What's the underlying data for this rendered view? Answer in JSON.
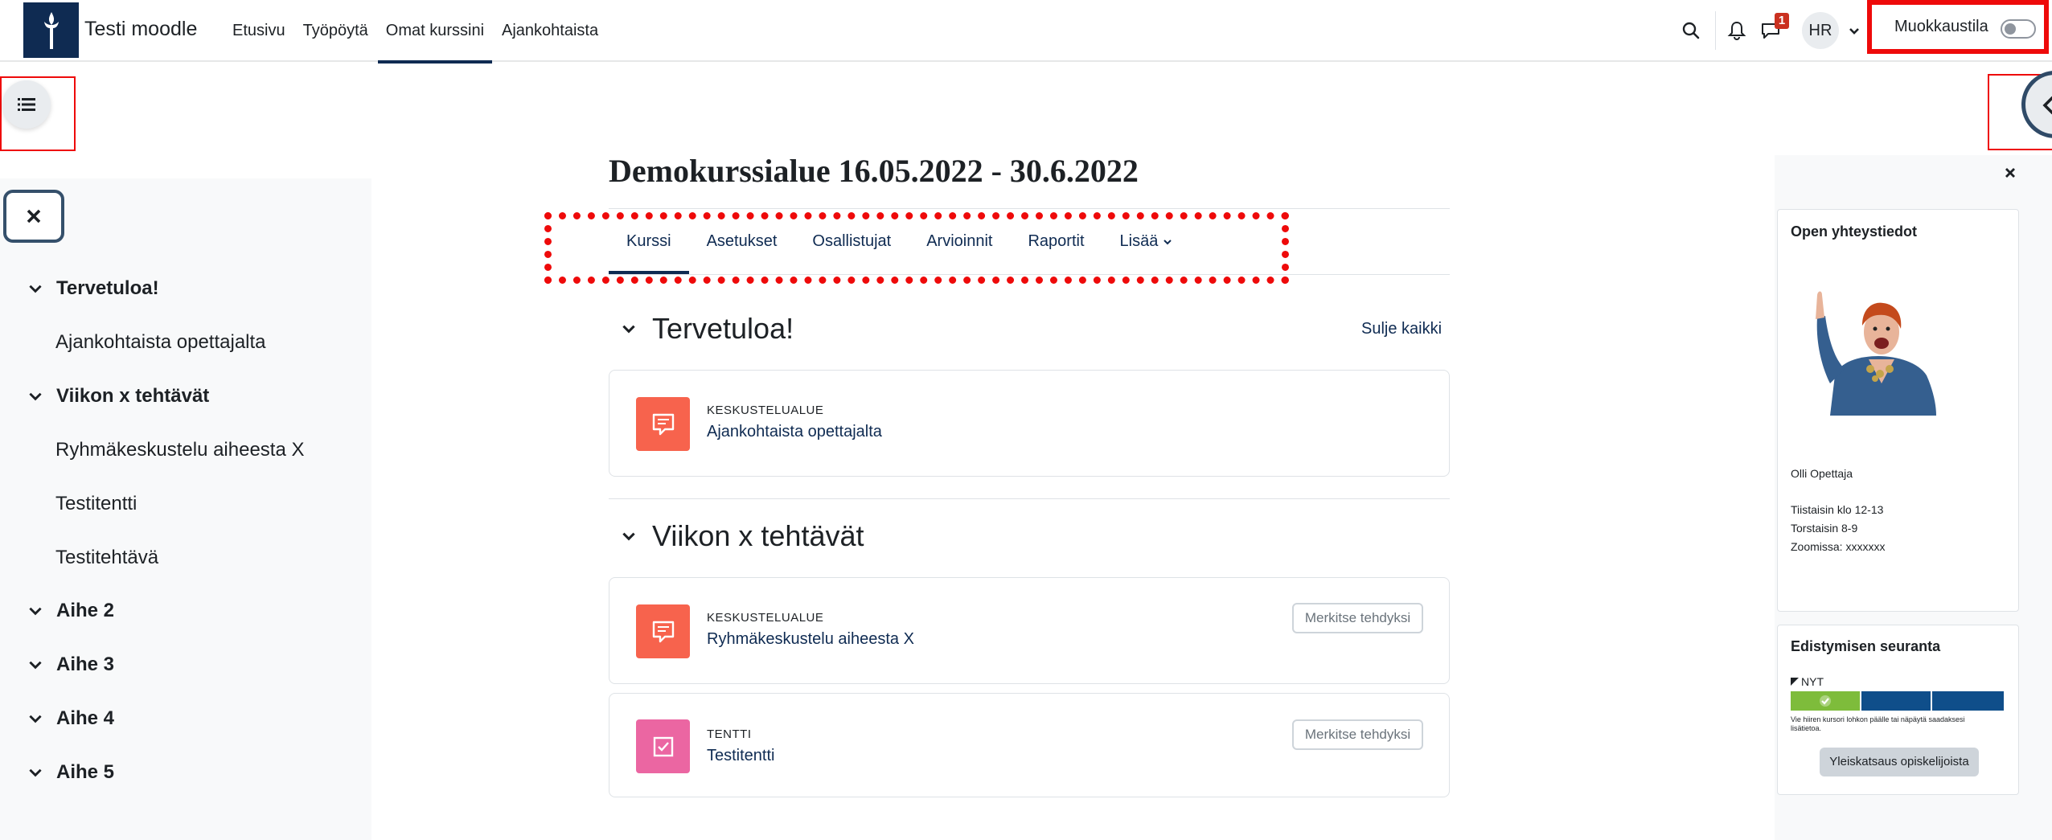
{
  "navbar": {
    "site_name": "Testi moodle",
    "primary_nav": [
      {
        "label": "Etusivu",
        "active": false
      },
      {
        "label": "Työpöytä",
        "active": false
      },
      {
        "label": "Omat kurssini",
        "active": true
      },
      {
        "label": "Ajankohtaista",
        "active": false
      }
    ],
    "messages_badge": "1",
    "user_initials": "HR",
    "edit_mode_label": "Muokkaustila",
    "edit_mode_on": false,
    "icons": [
      "search-icon",
      "bell-icon",
      "chat-icon",
      "chevron-down-icon"
    ]
  },
  "course_index": {
    "items": [
      {
        "label": "Tervetuloa!",
        "type": "section"
      },
      {
        "label": "Ajankohtaista opettajalta",
        "type": "activity"
      },
      {
        "label": "Viikon x tehtävät",
        "type": "section"
      },
      {
        "label": "Ryhmäkeskustelu aiheesta X",
        "type": "activity"
      },
      {
        "label": "Testitentti",
        "type": "activity"
      },
      {
        "label": "Testitehtävä",
        "type": "activity"
      },
      {
        "label": "Aihe 2",
        "type": "section"
      },
      {
        "label": "Aihe 3",
        "type": "section"
      },
      {
        "label": "Aihe 4",
        "type": "section"
      },
      {
        "label": "Aihe 5",
        "type": "section"
      }
    ]
  },
  "course": {
    "title": "Demokurssialue 16.05.2022 - 30.6.2022",
    "tabs": [
      {
        "label": "Kurssi",
        "active": true
      },
      {
        "label": "Asetukset",
        "active": false
      },
      {
        "label": "Osallistujat",
        "active": false
      },
      {
        "label": "Arvioinnit",
        "active": false
      },
      {
        "label": "Raportit",
        "active": false
      },
      {
        "label": "Lisää",
        "active": false
      }
    ],
    "collapse_all": "Sulje kaikki",
    "sections": [
      {
        "title": "Tervetuloa!",
        "activities": [
          {
            "type": "KESKUSTELUALUE",
            "name": "Ajankohtaista opettajalta",
            "mark_done": ""
          }
        ]
      },
      {
        "title": "Viikon x tehtävät",
        "activities": [
          {
            "type": "KESKUSTELUALUE",
            "name": "Ryhmäkeskustelu aiheesta X",
            "mark_done": "Merkitse tehdyksi"
          },
          {
            "type": "TENTTI",
            "name": "Testitentti",
            "mark_done": "Merkitse tehdyksi"
          }
        ]
      }
    ]
  },
  "blocks": {
    "contact": {
      "title": "Open yhteystiedot",
      "name": "Olli Opettaja",
      "hours": [
        "Tiistaisin klo 12-13",
        "Torstaisin 8-9",
        "Zoomissa: xxxxxxx"
      ]
    },
    "progress": {
      "title": "Edistymisen seuranta",
      "now_label": "NYT",
      "hint": "Vie hiiren kursori lohkon päälle tai näpäytä saadaksesi lisätietoa.",
      "segments": [
        "done",
        "todo",
        "todo"
      ],
      "overview_button": "Yleiskatsaus opiskelijoista"
    }
  },
  "colors": {
    "brand_navy": "#0f2b52",
    "annotation_red": "#ee0a0a",
    "forum_icon": "#f7634d",
    "quiz_icon": "#eb66a2",
    "progress_done": "#7ebc3b",
    "progress_todo": "#0f4e8a"
  }
}
